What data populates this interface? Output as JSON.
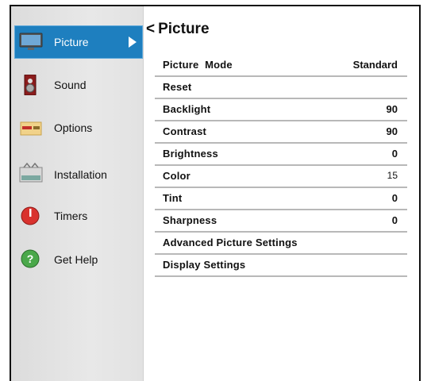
{
  "sidebar": {
    "items": [
      {
        "label": "Picture",
        "icon": "tv-icon",
        "active": true
      },
      {
        "label": "Sound",
        "icon": "speaker-icon"
      },
      {
        "label": "Options",
        "icon": "options-icon"
      },
      {
        "label": "Installation",
        "icon": "installation-icon"
      },
      {
        "label": "Timers",
        "icon": "timer-icon"
      },
      {
        "label": "Get Help",
        "icon": "help-icon"
      }
    ]
  },
  "panel": {
    "back_glyph": "<",
    "title": "Picture",
    "rows": [
      {
        "label": "Picture  Mode",
        "value": "Standard"
      },
      {
        "label": "Reset",
        "value": ""
      },
      {
        "label": "Backlight",
        "value": "90"
      },
      {
        "label": "Contrast",
        "value": "90"
      },
      {
        "label": "Brightness",
        "value": "0"
      },
      {
        "label": "Color",
        "value": "15"
      },
      {
        "label": "Tint",
        "value": "0"
      },
      {
        "label": "Sharpness",
        "value": "0"
      },
      {
        "label": "Advanced Picture Settings",
        "value": ""
      },
      {
        "label": "Display Settings",
        "value": ""
      }
    ]
  },
  "colors": {
    "active_bg": "#1e7fbf",
    "sidebar_bg": "#e2e2e2",
    "separator": "#b8b8b8"
  }
}
